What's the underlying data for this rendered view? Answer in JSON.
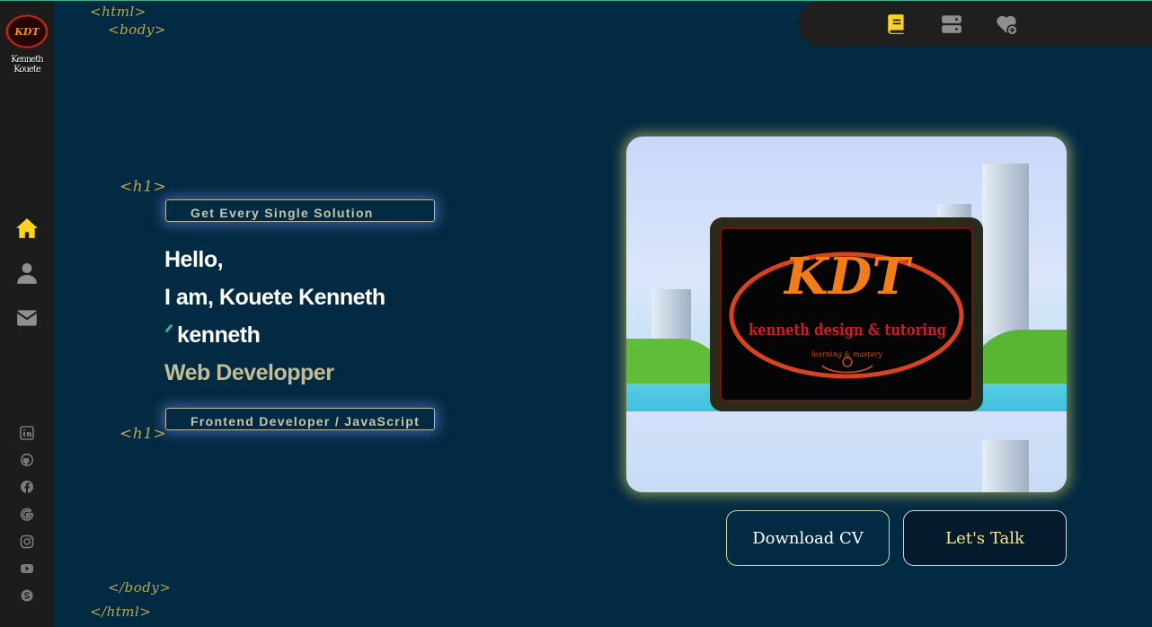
{
  "brand": {
    "name": "Kenneth Kouete",
    "logo_text": "KDT"
  },
  "code_tags": {
    "html_open": "<html>",
    "body_open": "<body>",
    "h1_open": "<h1>",
    "h1_close": "<h1>",
    "body_close": "</body>",
    "html_close": "</html>"
  },
  "hero": {
    "tagline": "Get Every Single Solution",
    "greeting": "Hello,",
    "intro": "I am, Kouete Kenneth",
    "typed": "kenneth",
    "role": "Web Developper",
    "subtitle": "Frontend Developer / JavaScript"
  },
  "card_logo": {
    "letters": "KDT",
    "company": "kenneth design & tutoring",
    "slogan": "learning & mastery"
  },
  "buttons": {
    "download_cv": "Download CV",
    "lets_talk": "Let's Talk"
  },
  "nav": {
    "side": [
      "home-icon",
      "user-icon",
      "envelope-icon"
    ],
    "top": [
      "book-icon",
      "server-icon",
      "heart-plus-icon"
    ],
    "social": [
      "linkedin-icon",
      "github-icon",
      "facebook-icon",
      "google-icon",
      "instagram-icon",
      "youtube-icon",
      "skype-icon"
    ]
  },
  "colors": {
    "background": "#032a43",
    "sidebar": "#1c1c1c",
    "accent": "#ffd21f",
    "tag": "#b9a84a",
    "muted_icon": "#8f8f8f"
  }
}
